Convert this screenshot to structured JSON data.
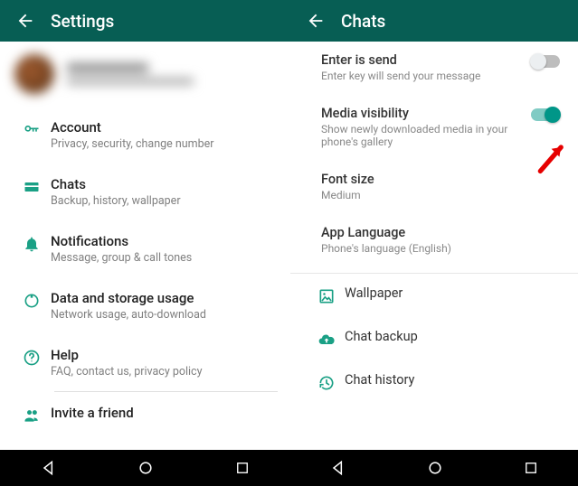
{
  "left": {
    "header": {
      "title": "Settings"
    },
    "items": [
      {
        "title": "Account",
        "sub": "Privacy, security, change number"
      },
      {
        "title": "Chats",
        "sub": "Backup, history, wallpaper"
      },
      {
        "title": "Notifications",
        "sub": "Message, group & call tones"
      },
      {
        "title": "Data and storage usage",
        "sub": "Network usage, auto-download"
      },
      {
        "title": "Help",
        "sub": "FAQ, contact us, privacy policy"
      },
      {
        "title": "Invite a friend"
      }
    ]
  },
  "right": {
    "header": {
      "title": "Chats"
    },
    "settings": [
      {
        "title": "Enter is send",
        "sub": "Enter key will send your message",
        "toggle": false
      },
      {
        "title": "Media visibility",
        "sub": "Show newly downloaded media in your phone's gallery",
        "toggle": true
      },
      {
        "title": "Font size",
        "sub": "Medium"
      },
      {
        "title": "App Language",
        "sub": "Phone's language (English)"
      }
    ],
    "links": [
      {
        "title": "Wallpaper"
      },
      {
        "title": "Chat backup"
      },
      {
        "title": "Chat history"
      }
    ]
  },
  "colors": {
    "appbar": "#075e54",
    "accent": "#009688",
    "icon": "#1aa085"
  }
}
